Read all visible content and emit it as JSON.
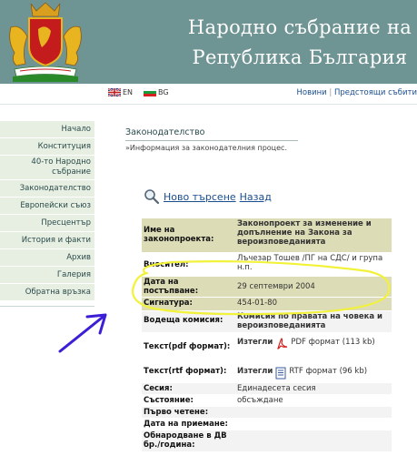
{
  "header": {
    "title_line1": "Народно събрание на",
    "title_line2": "Република България"
  },
  "lang": {
    "en": "EN",
    "bg": "BG"
  },
  "top_links": {
    "news": "Новини",
    "separator": "|",
    "upcoming": "Предстоящи събити"
  },
  "sidebar": {
    "items": [
      {
        "label": "Начало"
      },
      {
        "label": "Конституция"
      },
      {
        "label": "40-то Народно събрание"
      },
      {
        "label": "Законодателство"
      },
      {
        "label": "Европейски съюз"
      },
      {
        "label": "Пресцентър"
      },
      {
        "label": "История и факти"
      },
      {
        "label": "Архив"
      },
      {
        "label": "Галерия"
      },
      {
        "label": "Обратна връзка"
      }
    ]
  },
  "main": {
    "title": "Законодателство",
    "subtitle": "»Информация за законодателния процес.",
    "new_search": "Ново търсене",
    "back": "Назад"
  },
  "table": {
    "rows": [
      {
        "label": "Име на законопроекта:",
        "value": "Законопроект за изменение и допълнение на Закона за вероизповеданията"
      },
      {
        "label": "Вносител:",
        "value": "Лъчезар Тошев /ПГ на СДС/ и група н.п."
      },
      {
        "label": "Дата на постъпване:",
        "value": "29 септември 2004"
      },
      {
        "label": "Сигнатура:",
        "value": "454-01-80"
      },
      {
        "label": "Водеща комисия:",
        "value": "Комисия по правата на човека и вероизповеданията"
      },
      {
        "label": "Текст(pdf формат):",
        "download": "Изтегли",
        "file": "PDF формат (113 kb)"
      },
      {
        "label": "Текст(rtf формат):",
        "download": "Изтегли",
        "file": "RTF формат (96 kb)"
      },
      {
        "label": "Сесия:",
        "value": "Единадесета сесия"
      },
      {
        "label": "Състояние:",
        "value": "обсъждане"
      },
      {
        "label": "Първо четене:",
        "value": ""
      },
      {
        "label": "Дата на приемане:",
        "value": ""
      },
      {
        "label": "Обнародване в ДВ бр./година:",
        "value": ""
      }
    ]
  },
  "colors": {
    "header": "#6f9494",
    "nav_bg": "#e7efe3",
    "row_highlight": "#dcdcb6",
    "annotation_ellipse": "#f2f23a",
    "annotation_arrow": "#3a1fd6",
    "link": "#1a4d8c"
  },
  "icons": [
    "coat-of-arms-logo",
    "uk-flag-icon",
    "bg-flag-icon",
    "search-magnifier-icon",
    "pdf-icon",
    "rtf-document-icon"
  ]
}
